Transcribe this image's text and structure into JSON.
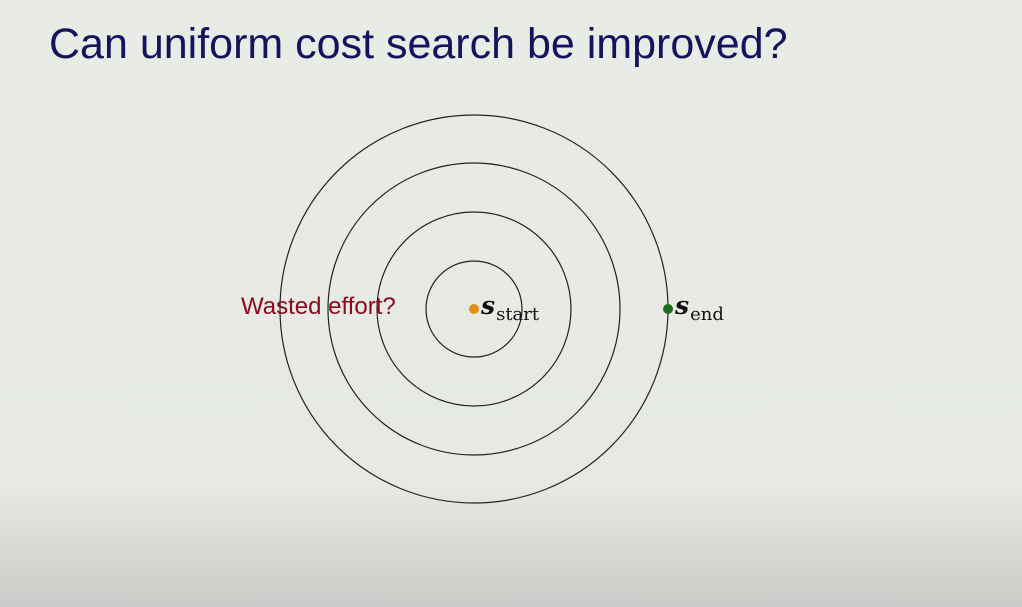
{
  "title": "Can uniform cost search be improved?",
  "diagram": {
    "annotation": "Wasted effort?",
    "start_label": {
      "symbol": "s",
      "subscript": "start"
    },
    "end_label": {
      "symbol": "s",
      "subscript": "end"
    },
    "colors": {
      "start": "#e0901a",
      "end": "#1a6b1a",
      "annotation": "#8b0a1a",
      "title": "#14145e"
    },
    "circle_count": 4
  }
}
